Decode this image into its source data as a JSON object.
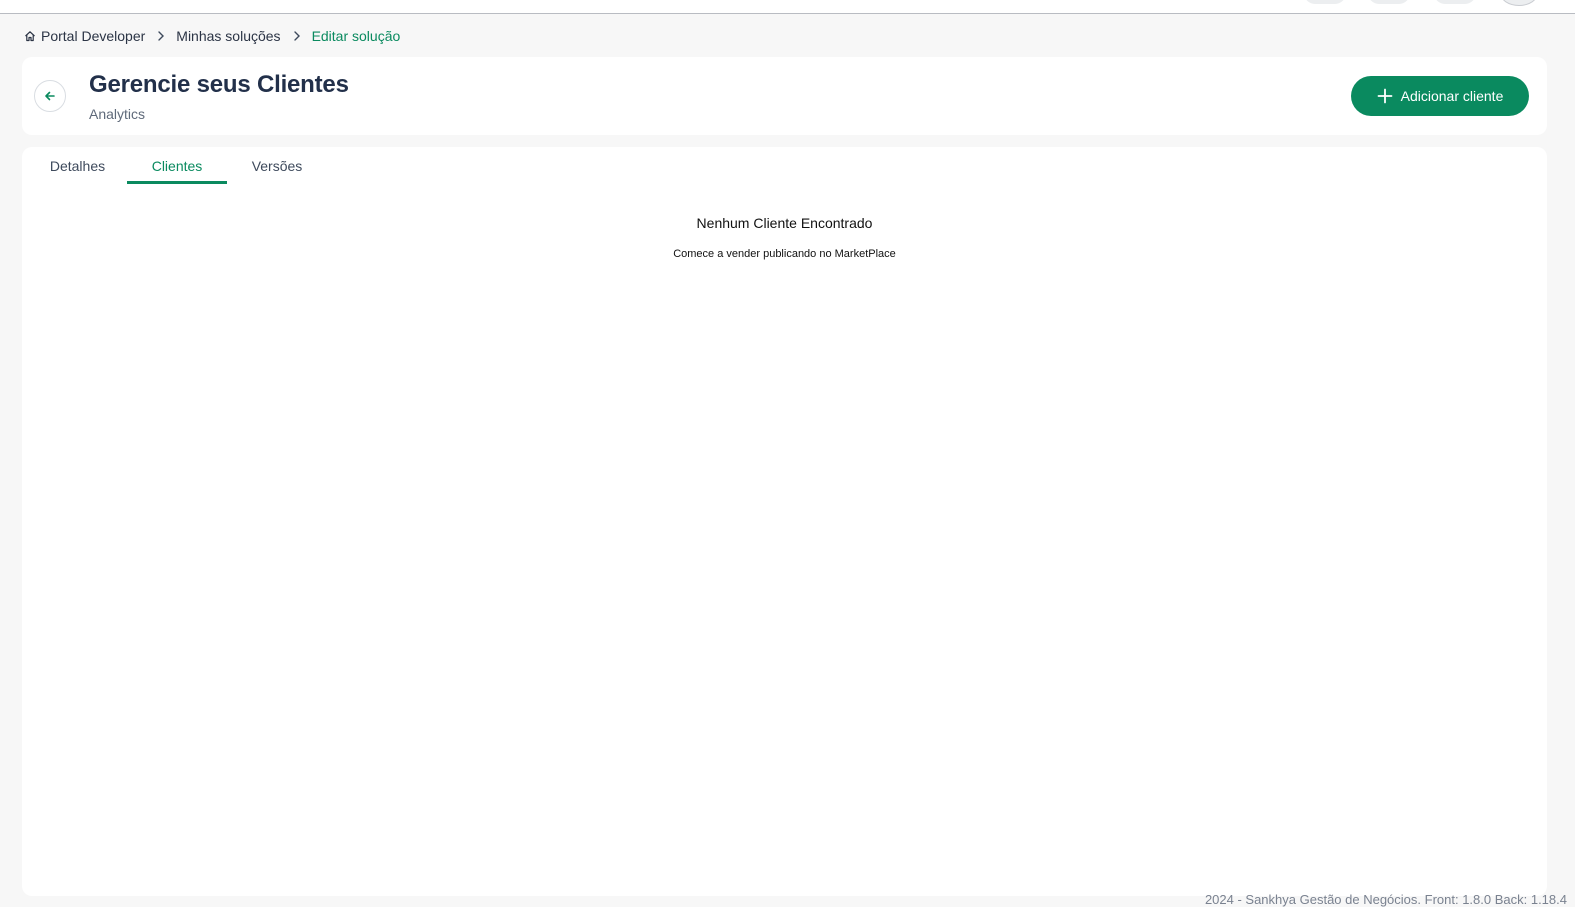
{
  "breadcrumb": {
    "items": [
      {
        "label": "Portal Developer"
      },
      {
        "label": "Minhas soluções"
      },
      {
        "label": "Editar solução"
      }
    ]
  },
  "header": {
    "title": "Gerencie seus Clientes",
    "subtitle": "Analytics",
    "add_button_label": "Adicionar cliente"
  },
  "tabs": [
    {
      "label": "Detalhes",
      "active": false
    },
    {
      "label": "Clientes",
      "active": true
    },
    {
      "label": "Versões",
      "active": false
    }
  ],
  "empty_state": {
    "title": "Nenhum Cliente Encontrado",
    "subtitle": "Comece a vender publicando no MarketPlace"
  },
  "footer": {
    "text": "2024 - Sankhya Gestão de Negócios. Front: 1.8.0 Back: 1.18.4"
  },
  "colors": {
    "accent": "#0a8a5f",
    "title": "#22304a",
    "background": "#f7f7f7"
  },
  "icons": [
    "home-icon",
    "chevron-right-icon",
    "arrow-left-icon",
    "plus-icon"
  ]
}
